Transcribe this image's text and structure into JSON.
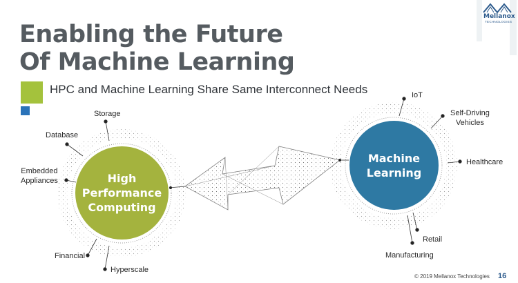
{
  "title": {
    "line1": "Enabling the Future",
    "line2": "Of Machine Learning"
  },
  "subtitle": "HPC and Machine Learning Share Same Interconnect Needs",
  "logo": {
    "name": "Mellanox",
    "tagline": "TECHNOLOGIES"
  },
  "hpc_circle": {
    "line1": "High",
    "line2": "Performance",
    "line3": "Computing",
    "color": "#a4b33e"
  },
  "ml_circle": {
    "line1": "Machine",
    "line2": "Learning",
    "color": "#2e79a3"
  },
  "hpc_labels": {
    "storage": "Storage",
    "database": "Database",
    "embedded_1": "Embedded",
    "embedded_2": "Appliances",
    "financial": "Financial",
    "hyperscale": "Hyperscale"
  },
  "ml_labels": {
    "iot": "IoT",
    "self_driving_1": "Self-Driving",
    "self_driving_2": "Vehicles",
    "healthcare": "Healthcare",
    "retail": "Retail",
    "manufacturing": "Manufacturing"
  },
  "footer": {
    "copyright": "© 2019 Mellanox Technologies",
    "page_number": "16"
  },
  "colors": {
    "accent_green": "#a4c23c",
    "accent_blue": "#2a73b9",
    "title_gray": "#555b60"
  }
}
